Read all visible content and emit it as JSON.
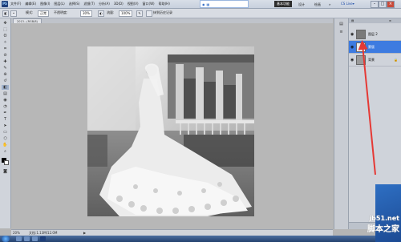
{
  "app": {
    "logo": "PS"
  },
  "menus": [
    "文件(F)",
    "编辑(E)",
    "图像(I)",
    "图层(L)",
    "选择(S)",
    "滤镜(T)",
    "分析(A)",
    "3D(D)",
    "视图(V)",
    "窗口(W)",
    "帮助(H)"
  ],
  "workspace": {
    "active": "基本功能",
    "links": [
      "设计",
      "绘画"
    ],
    "more": "»",
    "cs_live": "CS Live▾"
  },
  "options": {
    "mode_label": "模式:",
    "mode_value": "正常",
    "opacity_label": "不透明度:",
    "opacity_value": "30%",
    "flow_label": "流量:",
    "flow_value": "100%",
    "checkbox_label": "抹到历史记录"
  },
  "document_tab": "2013...(RGB/8)",
  "status": {
    "zoom": "20%",
    "doc_info": "文档:1.13M/12.0M"
  },
  "layers": [
    {
      "name": "图层 2",
      "selected": false
    },
    {
      "name": "蒙版",
      "selected": true
    },
    {
      "name": "背景",
      "selected": false
    }
  ],
  "watermark": {
    "site": "jb51.net",
    "brand": "脚本之家"
  },
  "arrow_color": "#e53935"
}
